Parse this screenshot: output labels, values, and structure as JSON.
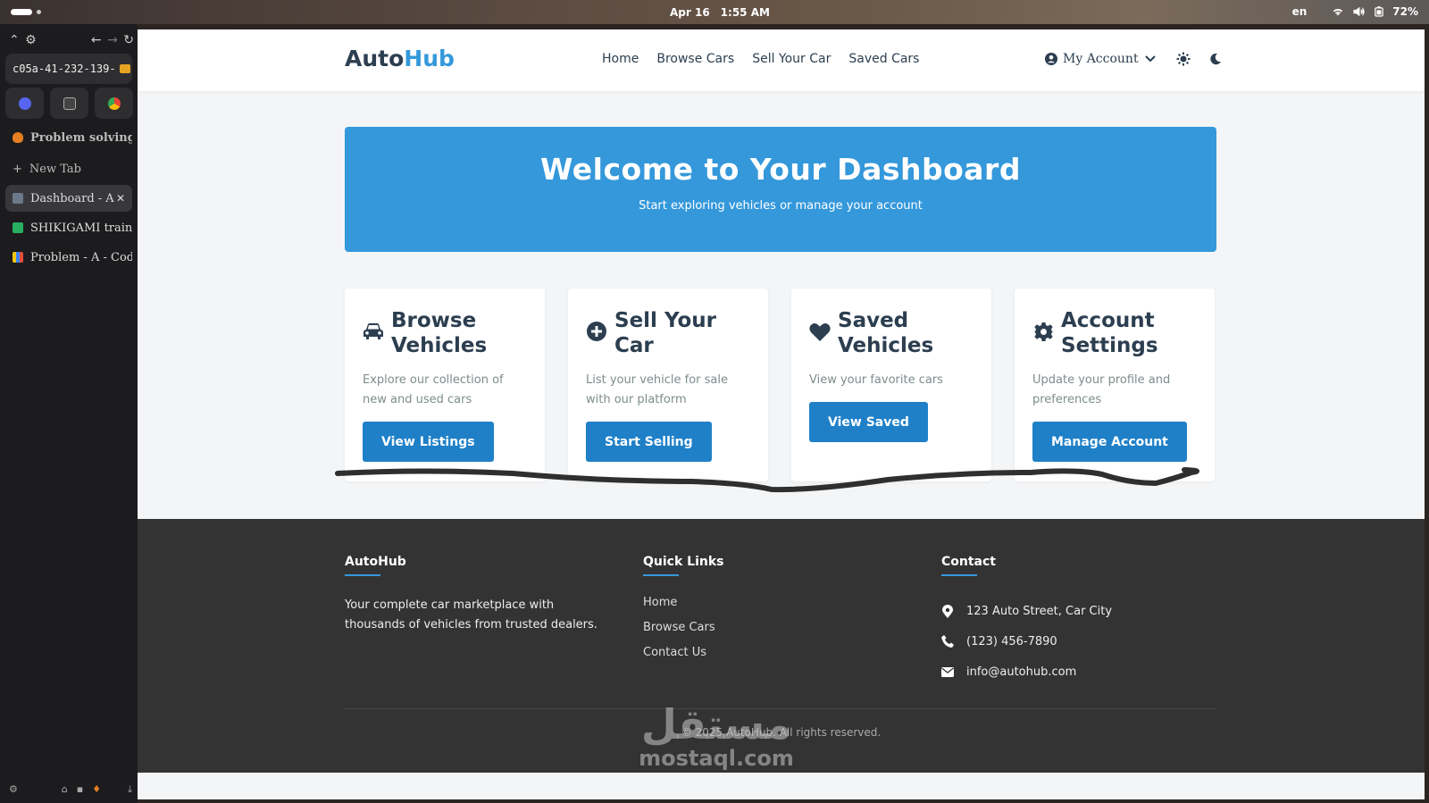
{
  "os": {
    "date": "Apr 16",
    "time": "1:55 AM",
    "lang": "en",
    "battery": "72%"
  },
  "browser": {
    "url": "c05a-41-232-139-",
    "tabs": [
      {
        "label": "Problem solving",
        "color": "#e67e22"
      },
      {
        "label": "New Tab",
        "color": ""
      },
      {
        "label": "Dashboard - A",
        "color": "#6b7a8a",
        "active": true
      },
      {
        "label": "SHIKIGAMI train",
        "color": "#27ae60"
      },
      {
        "label": "Problem - A - Cod",
        "color": "#3b82f6"
      }
    ],
    "close_glyph": "✕"
  },
  "header": {
    "logo_a": "Auto",
    "logo_b": "Hub",
    "nav": [
      "Home",
      "Browse Cars",
      "Sell Your Car",
      "Saved Cars"
    ],
    "account_label": "My Account"
  },
  "hero": {
    "title": "Welcome to Your Dashboard",
    "subtitle": "Start exploring vehicles or manage your account"
  },
  "cards": [
    {
      "icon": "car-icon",
      "title": "Browse Vehicles",
      "desc": "Explore our collection of new and used cars",
      "button": "View Listings"
    },
    {
      "icon": "plus-circle-icon",
      "title": "Sell Your Car",
      "desc": "List your vehicle for sale with our platform",
      "button": "Start Selling"
    },
    {
      "icon": "heart-icon",
      "title": "Saved Vehicles",
      "desc": "View your favorite cars",
      "button": "View Saved"
    },
    {
      "icon": "gear-icon",
      "title": "Account Settings",
      "desc": "Update your profile and preferences",
      "button": "Manage Account"
    }
  ],
  "footer": {
    "brand_title": "AutoHub",
    "brand_text": "Your complete car marketplace with thousands of vehicles from trusted dealers.",
    "links_title": "Quick Links",
    "links": [
      "Home",
      "Browse Cars",
      "Contact Us"
    ],
    "contact_title": "Contact",
    "address": "123 Auto Street, Car City",
    "phone": "(123) 456-7890",
    "email": "info@autohub.com",
    "copyright": "© 2025 AutoHub. All rights reserved."
  },
  "watermark": {
    "arabic": "مستقل",
    "latin": "mostaql.com"
  },
  "colors": {
    "accent": "#3498db",
    "button": "#1f80c8",
    "footer_bg": "#333333"
  }
}
